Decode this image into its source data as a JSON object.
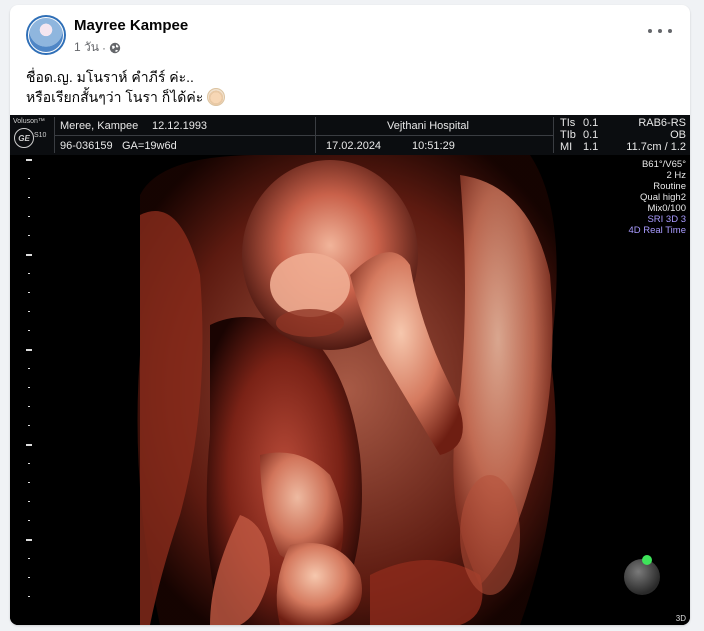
{
  "post": {
    "author": "Mayree Kampee",
    "time": "1 วัน",
    "separator": "·",
    "privacy_icon": "globe-icon",
    "more_icon": "more-horizontal-icon",
    "text_line1": "ชื่อด.ญ. มโนราห์ คำภีร์ ค่ะ..",
    "text_line2": "หรือเรียกสั้นๆว่า โนรา ก็ได้ค่ะ",
    "emoji": "baby-emoji"
  },
  "ultrasound": {
    "brand": "Voluson™",
    "model": "S10",
    "brand_mark": "GE",
    "patient": "Meree, Kampee",
    "dob": "12.12.1993",
    "patient_id": "96-036159",
    "ga": "GA=19w6d",
    "hospital": "Vejthani Hospital",
    "date": "17.02.2024",
    "time": "10:51:29",
    "tis": "TIs",
    "tis_val": "0.1",
    "tib": "TIb",
    "tib_val": "0.1",
    "mi": "MI",
    "mi_val": "1.1",
    "probe": "RAB6-RS",
    "preset": "OB",
    "depth": "11.7cm / 1.2",
    "params": [
      "B61°/V65°",
      "2 Hz",
      "Routine",
      "Qual high2",
      "Mix0/100"
    ],
    "mode1": "SRI 3D 3",
    "mode2": "4D Real Time",
    "corner": "3D",
    "colors": {
      "accent_purple": "#a99bff",
      "orb_green": "#3ee35a"
    }
  }
}
